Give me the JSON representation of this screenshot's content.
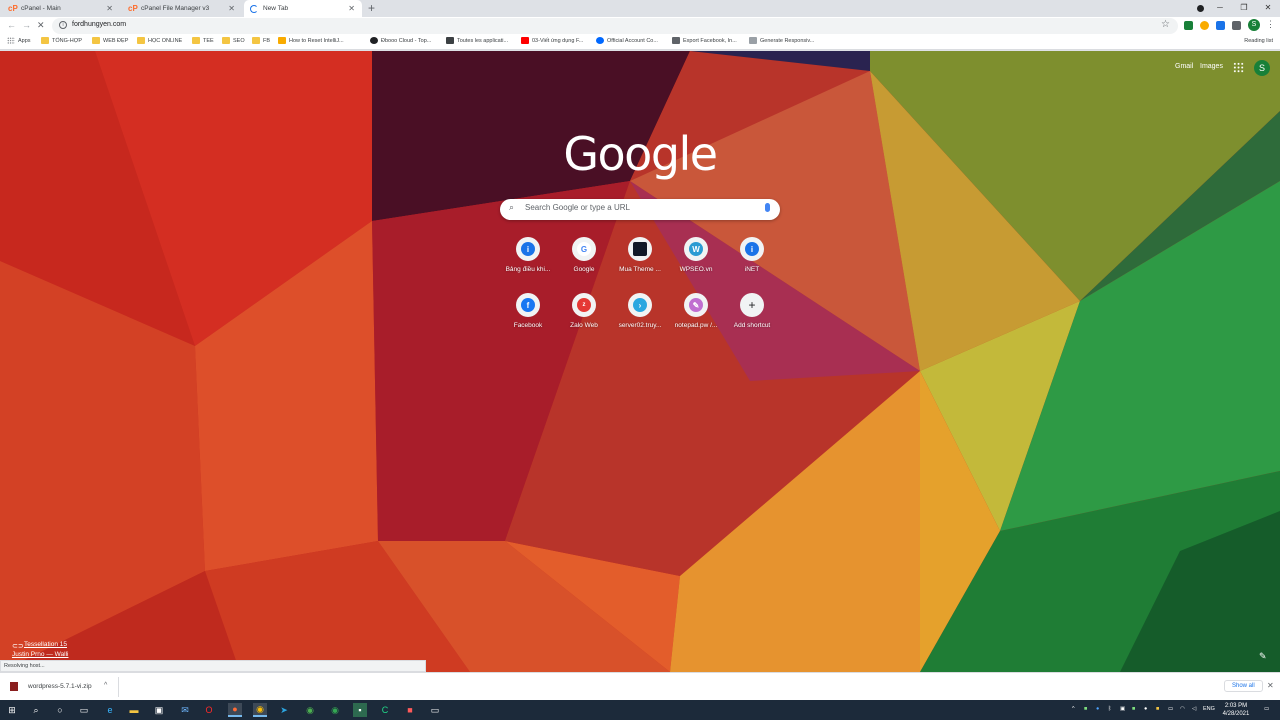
{
  "tabs": [
    {
      "title": "cPanel - Main",
      "icon": "cpanel-icon",
      "active": false
    },
    {
      "title": "cPanel File Manager v3",
      "icon": "cpanel-icon",
      "active": false
    },
    {
      "title": "New Tab",
      "icon": "loading-spinner-icon",
      "active": true
    }
  ],
  "omnibox": {
    "url": "fordhungyen.com"
  },
  "bookmarks": [
    {
      "label": "Apps",
      "icon": "apps-grid-icon"
    },
    {
      "label": "TỔNG-HỢP",
      "icon": "folder-icon"
    },
    {
      "label": "WEB ĐẸP",
      "icon": "folder-icon"
    },
    {
      "label": "HỌC ONLINE",
      "icon": "folder-icon"
    },
    {
      "label": "TEE",
      "icon": "folder-icon"
    },
    {
      "label": "SEO",
      "icon": "folder-icon"
    },
    {
      "label": "FB",
      "icon": "folder-icon"
    },
    {
      "label": "How to Reset IntelliJ...",
      "icon": "page-icon"
    },
    {
      "label": "Đbooo Cloud - Top...",
      "icon": "cloud-icon"
    },
    {
      "label": "Toutes les applicati...",
      "icon": "apps-icon"
    },
    {
      "label": "03-Viết ứng dụng F...",
      "icon": "youtube-icon"
    },
    {
      "label": "Official Account Co...",
      "icon": "zalo-icon"
    },
    {
      "label": "Export Facebook, In...",
      "icon": "export-icon"
    },
    {
      "label": "Generate Responsiv...",
      "icon": "page-icon"
    }
  ],
  "reading_list": "Reading list",
  "header_links": {
    "gmail": "Gmail",
    "images": "Images",
    "avatar_letter": "S"
  },
  "logo_text": "Google",
  "search": {
    "placeholder": "Search Google or type a URL"
  },
  "shortcuts": [
    {
      "label": "Bảng điều khi...",
      "icon": "info-icon",
      "color": "#1a73e8"
    },
    {
      "label": "Google",
      "icon": "google-icon",
      "color": "#4285f4"
    },
    {
      "label": "Mua Theme ...",
      "icon": "dark-square-icon",
      "color": "#111827"
    },
    {
      "label": "WPSEO.vn",
      "icon": "wordpress-icon",
      "color": "#2b9bd3"
    },
    {
      "label": "iNET",
      "icon": "info-icon",
      "color": "#1a73e8"
    },
    {
      "label": "Facebook",
      "icon": "facebook-icon",
      "color": "#1877f2"
    },
    {
      "label": "Zalo Web",
      "icon": "zalo-web-icon",
      "color": "#e53935"
    },
    {
      "label": "server02.truy...",
      "icon": "arrow-icon",
      "color": "#2aa7e0"
    },
    {
      "label": "notepad.pw /...",
      "icon": "notepad-icon",
      "color": "#c06fd0"
    },
    {
      "label": "Add shortcut",
      "icon": "plus-icon",
      "color": "#202124"
    }
  ],
  "background_credit": {
    "title": "Tessellation 15",
    "author": "Justin Prno — Walli"
  },
  "status_text": "Resolving host...",
  "download": {
    "filename": "wordpress-5.7.1-vi.zip",
    "show_all": "Show all"
  },
  "taskbar": {
    "language": "ENG",
    "time": "2:03 PM",
    "date": "4/28/2021"
  }
}
